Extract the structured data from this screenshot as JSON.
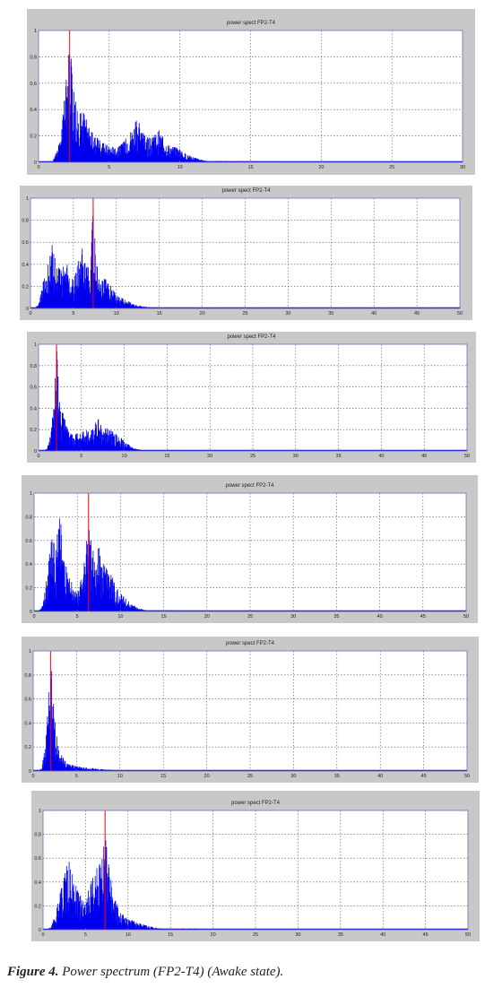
{
  "chart_data": [
    {
      "type": "area",
      "title": "power spect FP2-T4",
      "xlim": [
        0,
        30
      ],
      "ylim": [
        0,
        1
      ],
      "xticks": [
        0,
        5,
        10,
        15,
        20,
        25,
        30
      ],
      "yticks": [
        0,
        0.2,
        0.4,
        0.6,
        0.8,
        1
      ],
      "grid": true,
      "peak_marker": 2.2,
      "envelope": [
        [
          0.5,
          0
        ],
        [
          1,
          0.01
        ],
        [
          1.5,
          0.15
        ],
        [
          1.9,
          0.55
        ],
        [
          2.1,
          0.8
        ],
        [
          2.2,
          1
        ],
        [
          2.4,
          0.6
        ],
        [
          2.8,
          0.35
        ],
        [
          3.2,
          0.4
        ],
        [
          3.6,
          0.25
        ],
        [
          4,
          0.2
        ],
        [
          4.5,
          0.15
        ],
        [
          5,
          0.13
        ],
        [
          5.5,
          0.1
        ],
        [
          6,
          0.15
        ],
        [
          6.5,
          0.24
        ],
        [
          7,
          0.33
        ],
        [
          7.5,
          0.2
        ],
        [
          8,
          0.18
        ],
        [
          8.5,
          0.25
        ],
        [
          9,
          0.15
        ],
        [
          9.5,
          0.12
        ],
        [
          10,
          0.1
        ],
        [
          10.5,
          0.06
        ],
        [
          11,
          0.04
        ],
        [
          11.5,
          0.02
        ],
        [
          12,
          0.01
        ],
        [
          30,
          0
        ]
      ]
    },
    {
      "type": "area",
      "title": "power spect FP2-T4",
      "xlim": [
        0,
        50
      ],
      "ylim": [
        0,
        1
      ],
      "xticks": [
        0,
        5,
        10,
        15,
        20,
        25,
        30,
        35,
        40,
        45,
        50
      ],
      "yticks": [
        0,
        0.2,
        0.4,
        0.6,
        0.8,
        1
      ],
      "grid": true,
      "peak_marker": 7.3,
      "envelope": [
        [
          0.5,
          0
        ],
        [
          1,
          0.05
        ],
        [
          2,
          0.45
        ],
        [
          2.5,
          0.58
        ],
        [
          3,
          0.4
        ],
        [
          3.5,
          0.35
        ],
        [
          4,
          0.45
        ],
        [
          5,
          0.25
        ],
        [
          6,
          0.55
        ],
        [
          6.5,
          0.4
        ],
        [
          7,
          0.5
        ],
        [
          7.3,
          0.9
        ],
        [
          7.6,
          0.5
        ],
        [
          8,
          0.3
        ],
        [
          9,
          0.25
        ],
        [
          10,
          0.12
        ],
        [
          11,
          0.08
        ],
        [
          12,
          0.04
        ],
        [
          13,
          0.02
        ],
        [
          14,
          0.01
        ],
        [
          50,
          0
        ]
      ]
    },
    {
      "type": "area",
      "title": "power spect FP2-T4",
      "xlim": [
        0,
        50
      ],
      "ylim": [
        0,
        1
      ],
      "xticks": [
        0,
        5,
        10,
        15,
        20,
        25,
        30,
        35,
        40,
        45,
        50
      ],
      "yticks": [
        0,
        0.2,
        0.4,
        0.6,
        0.8,
        1
      ],
      "grid": true,
      "peak_marker": 2.1,
      "envelope": [
        [
          0.5,
          0
        ],
        [
          1,
          0.02
        ],
        [
          1.5,
          0.2
        ],
        [
          1.9,
          0.6
        ],
        [
          2.1,
          1
        ],
        [
          2.4,
          0.5
        ],
        [
          3,
          0.32
        ],
        [
          3.5,
          0.18
        ],
        [
          4,
          0.15
        ],
        [
          5,
          0.18
        ],
        [
          6,
          0.2
        ],
        [
          7,
          0.3
        ],
        [
          7.5,
          0.2
        ],
        [
          8,
          0.22
        ],
        [
          9,
          0.16
        ],
        [
          10,
          0.1
        ],
        [
          10.5,
          0.06
        ],
        [
          11,
          0.03
        ],
        [
          12,
          0.01
        ],
        [
          50,
          0
        ]
      ]
    },
    {
      "type": "area",
      "title": "power spect FP2-T4",
      "xlim": [
        0,
        50
      ],
      "ylim": [
        0,
        1
      ],
      "xticks": [
        0,
        5,
        10,
        15,
        20,
        25,
        30,
        35,
        40,
        45,
        50
      ],
      "yticks": [
        0,
        0.2,
        0.4,
        0.6,
        0.8,
        1
      ],
      "grid": true,
      "peak_marker": 6.3,
      "envelope": [
        [
          0.5,
          0
        ],
        [
          1,
          0.05
        ],
        [
          1.5,
          0.3
        ],
        [
          2,
          0.62
        ],
        [
          2.5,
          0.55
        ],
        [
          3,
          0.88
        ],
        [
          3.3,
          0.5
        ],
        [
          4,
          0.3
        ],
        [
          5,
          0.15
        ],
        [
          5.5,
          0.3
        ],
        [
          6,
          0.55
        ],
        [
          6.3,
          0.72
        ],
        [
          7,
          0.45
        ],
        [
          7.5,
          0.55
        ],
        [
          8,
          0.4
        ],
        [
          9,
          0.3
        ],
        [
          10,
          0.15
        ],
        [
          11,
          0.08
        ],
        [
          12,
          0.03
        ],
        [
          13,
          0.01
        ],
        [
          50,
          0
        ]
      ]
    },
    {
      "type": "area",
      "title": "power spect FP2-T4",
      "xlim": [
        0,
        50
      ],
      "ylim": [
        0,
        1
      ],
      "xticks": [
        0,
        5,
        10,
        15,
        20,
        25,
        30,
        35,
        40,
        45,
        50
      ],
      "yticks": [
        0,
        0.2,
        0.4,
        0.6,
        0.8,
        1
      ],
      "grid": true,
      "peak_marker": 2.0,
      "envelope": [
        [
          0.5,
          0
        ],
        [
          1,
          0.02
        ],
        [
          1.5,
          0.3
        ],
        [
          1.8,
          0.8
        ],
        [
          2,
          1
        ],
        [
          2.3,
          0.6
        ],
        [
          2.6,
          0.35
        ],
        [
          3,
          0.18
        ],
        [
          3.5,
          0.1
        ],
        [
          4,
          0.06
        ],
        [
          5,
          0.04
        ],
        [
          6,
          0.03
        ],
        [
          8,
          0.015
        ],
        [
          10,
          0.005
        ],
        [
          50,
          0
        ]
      ]
    },
    {
      "type": "area",
      "title": "power spect FP2-T4",
      "xlim": [
        0,
        50
      ],
      "ylim": [
        0,
        1
      ],
      "xticks": [
        0,
        5,
        10,
        15,
        20,
        25,
        30,
        35,
        40,
        45,
        50
      ],
      "yticks": [
        0,
        0.2,
        0.4,
        0.6,
        0.8,
        1
      ],
      "grid": true,
      "peak_marker": 7.3,
      "envelope": [
        [
          0.5,
          0
        ],
        [
          1,
          0.03
        ],
        [
          1.5,
          0.15
        ],
        [
          2,
          0.3
        ],
        [
          3,
          0.6
        ],
        [
          3.5,
          0.45
        ],
        [
          4,
          0.35
        ],
        [
          5,
          0.2
        ],
        [
          5.5,
          0.4
        ],
        [
          6,
          0.45
        ],
        [
          6.5,
          0.55
        ],
        [
          7,
          0.6
        ],
        [
          7.3,
          0.8
        ],
        [
          7.8,
          0.5
        ],
        [
          8.5,
          0.25
        ],
        [
          9,
          0.15
        ],
        [
          10,
          0.1
        ],
        [
          11,
          0.06
        ],
        [
          12,
          0.04
        ],
        [
          13,
          0.02
        ],
        [
          14,
          0.01
        ],
        [
          50,
          0
        ]
      ]
    }
  ],
  "caption": {
    "label": "Figure 4.",
    "text": " Power spectrum (FP2-T4) (Awake state)."
  },
  "colors": {
    "fill": "#0000ee",
    "marker": "#ff0000",
    "grid": "#555555",
    "axes": "#6f6fb8",
    "frame": "#c8c8c8"
  }
}
